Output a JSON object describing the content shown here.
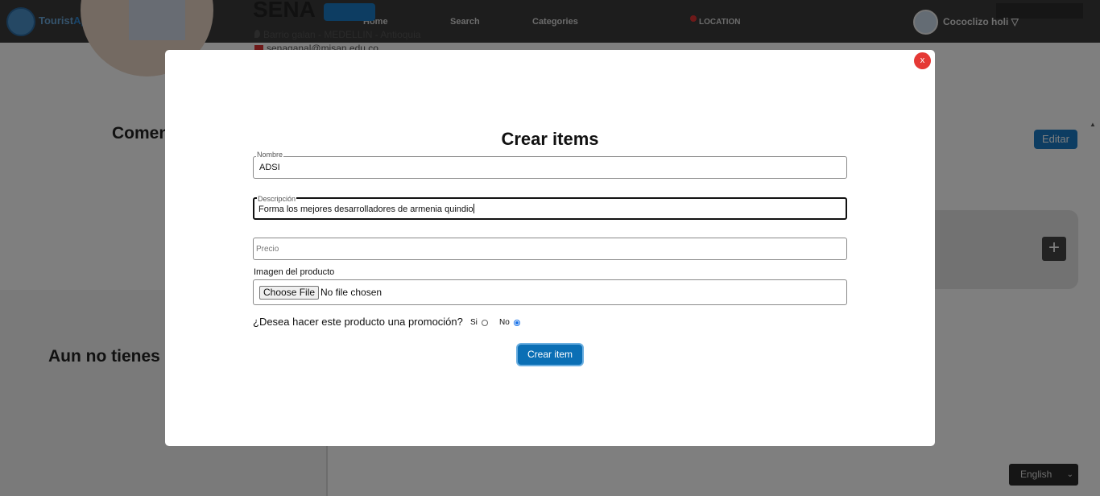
{
  "header": {
    "logo_text": "Tourist",
    "logo_text_accent": "App",
    "nav": [
      "Home",
      "Search",
      "Categories"
    ],
    "location_label": "LOCATION",
    "user_name": "Cococlizo holi ▽"
  },
  "profile": {
    "name": "SENA",
    "address": "Barrio galan - MEDELLIN - Antioquia",
    "email": "senaganal@misan.edu.co"
  },
  "page": {
    "comments_title": "Comen",
    "edit_label": "Editar",
    "add_label": "+",
    "no_items_text": "Aun no tienes",
    "scroll_arrow": "▲",
    "language": "English",
    "language_chevron": "⌄"
  },
  "modal": {
    "close_label": "x",
    "title": "Crear items",
    "name_field": {
      "legend": "Nombre",
      "value": "ADSI"
    },
    "description_field": {
      "legend": "Descripción",
      "value": "Forma los mejores desarrolladores de armenia quindio"
    },
    "price_field": {
      "placeholder": "Precio"
    },
    "image_label": "Imagen del producto",
    "choose_file_label": "Choose File",
    "no_file_text": "No file chosen",
    "promo_question": "¿Desea hacer este producto una promoción?",
    "promo_options": [
      {
        "label": "Si",
        "checked": false
      },
      {
        "label": "No",
        "checked": true
      }
    ],
    "submit_label": "Crear item"
  },
  "colors": {
    "primary": "#0b6fb5",
    "close": "#e53935",
    "topbar": "#3a3a3a"
  }
}
